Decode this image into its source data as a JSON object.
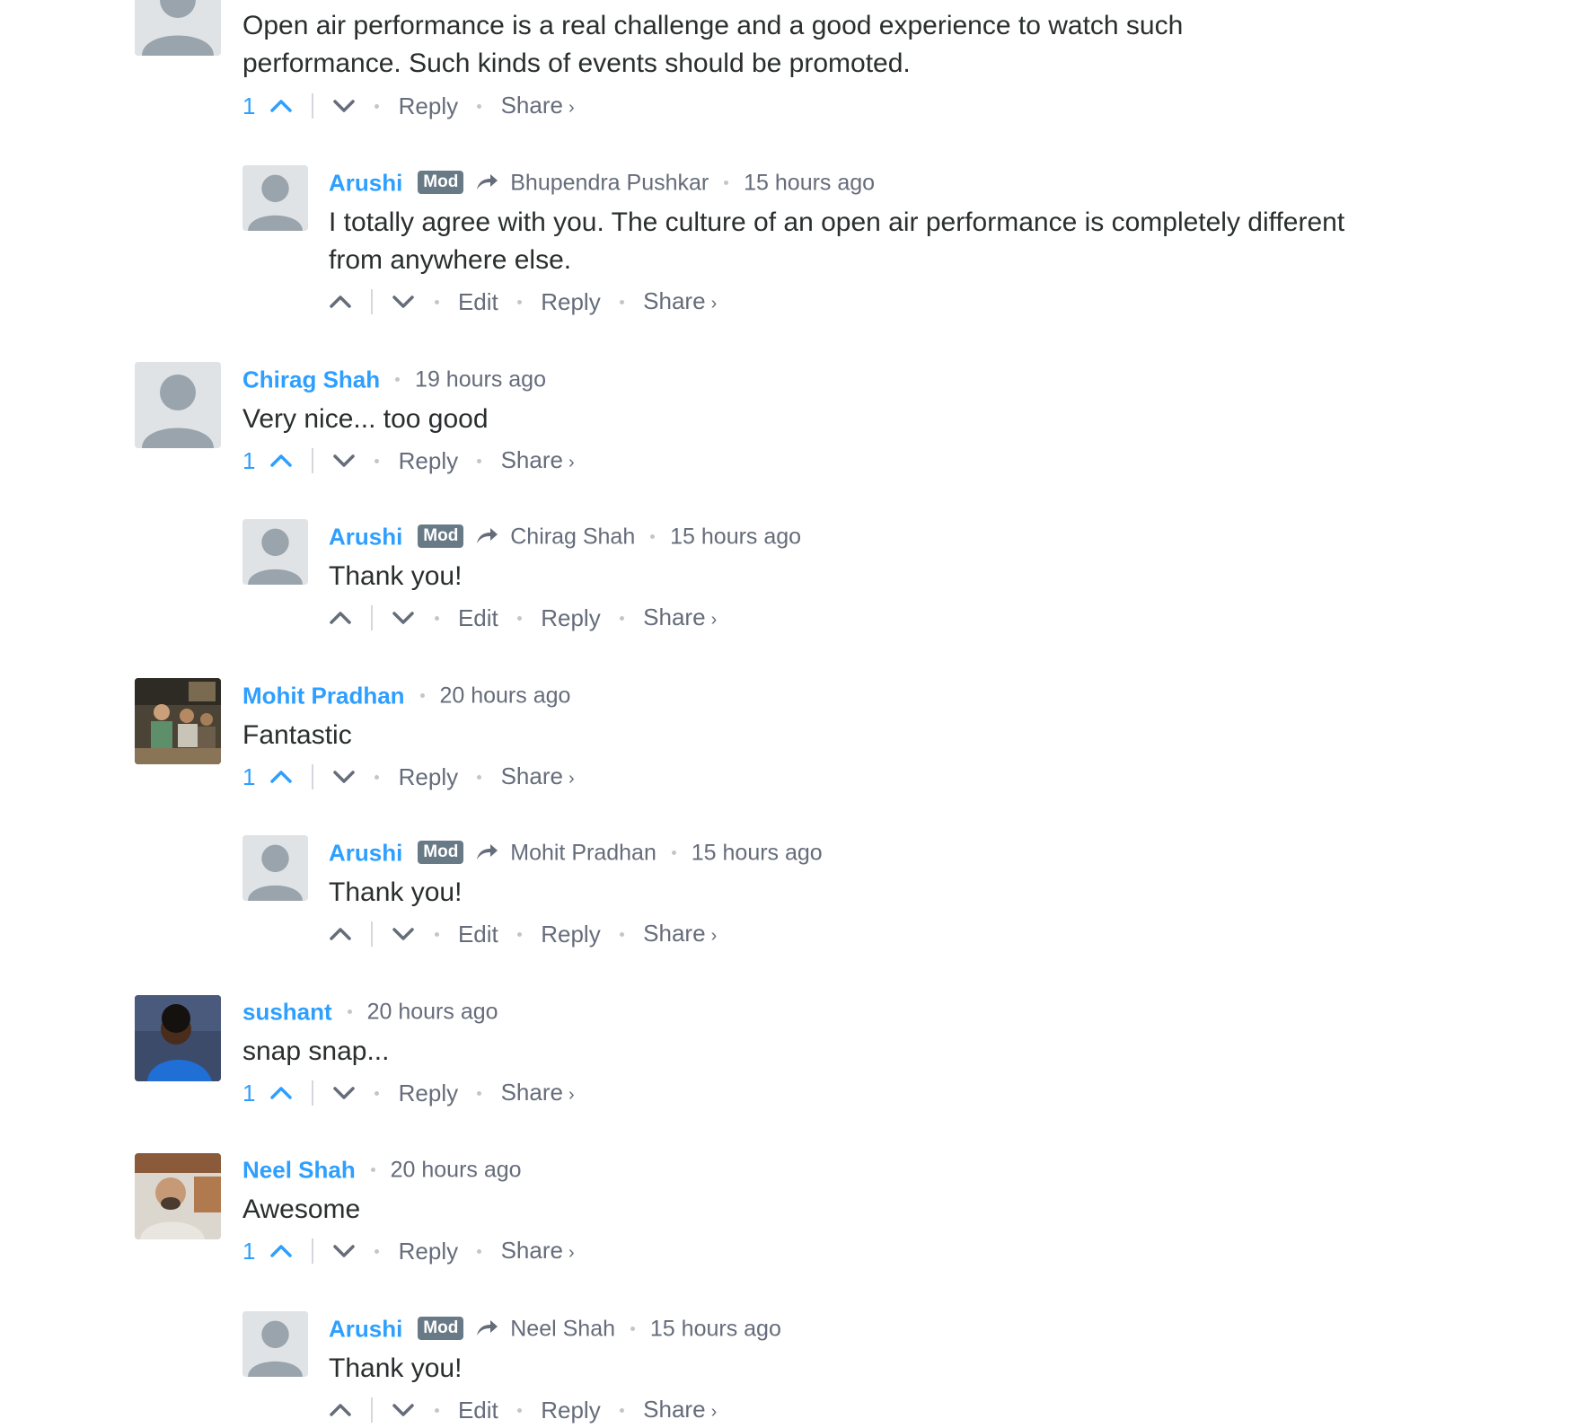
{
  "comments": [
    {
      "body": [
        "Open air performance is a real challenge and a good experience to watch such",
        "performance. Such kinds of events should be promoted."
      ],
      "votes": "1",
      "reply": "Reply",
      "share": "Share",
      "share_caret": "›"
    },
    {
      "author": "Arushi",
      "badge": "Mod",
      "in_reply_to": "Bhupendra Pushkar",
      "time": "15 hours ago",
      "body": [
        "I totally agree with you. The culture of an open air performance is completely different",
        "from anywhere else."
      ],
      "edit": "Edit",
      "reply": "Reply",
      "share": "Share",
      "share_caret": "›"
    },
    {
      "author": "Chirag Shah",
      "time": "19 hours ago",
      "body": [
        "Very nice... too good"
      ],
      "votes": "1",
      "reply": "Reply",
      "share": "Share",
      "share_caret": "›"
    },
    {
      "author": "Arushi",
      "badge": "Mod",
      "in_reply_to": "Chirag Shah",
      "time": "15 hours ago",
      "body": [
        "Thank you!"
      ],
      "edit": "Edit",
      "reply": "Reply",
      "share": "Share",
      "share_caret": "›"
    },
    {
      "author": "Mohit Pradhan",
      "time": "20 hours ago",
      "body": [
        "Fantastic"
      ],
      "votes": "1",
      "reply": "Reply",
      "share": "Share",
      "share_caret": "›"
    },
    {
      "author": "Arushi",
      "badge": "Mod",
      "in_reply_to": "Mohit Pradhan",
      "time": "15 hours ago",
      "body": [
        "Thank you!"
      ],
      "edit": "Edit",
      "reply": "Reply",
      "share": "Share",
      "share_caret": "›"
    },
    {
      "author": "sushant",
      "time": "20 hours ago",
      "body": [
        "snap snap..."
      ],
      "votes": "1",
      "reply": "Reply",
      "share": "Share",
      "share_caret": "›"
    },
    {
      "author": "Neel Shah",
      "time": "20 hours ago",
      "body": [
        "Awesome"
      ],
      "votes": "1",
      "reply": "Reply",
      "share": "Share",
      "share_caret": "›"
    },
    {
      "author": "Arushi",
      "badge": "Mod",
      "in_reply_to": "Neel Shah",
      "time": "15 hours ago",
      "body": [
        "Thank you!"
      ],
      "edit": "Edit",
      "reply": "Reply",
      "share": "Share",
      "share_caret": "›"
    }
  ],
  "colors": {
    "author": "#2e9fff",
    "meta": "#656c7a",
    "text": "#2a2e2e",
    "badge": "#687a86",
    "avatar_bg": "#dfe3e6",
    "avatar_fg": "#9aa4ad"
  }
}
